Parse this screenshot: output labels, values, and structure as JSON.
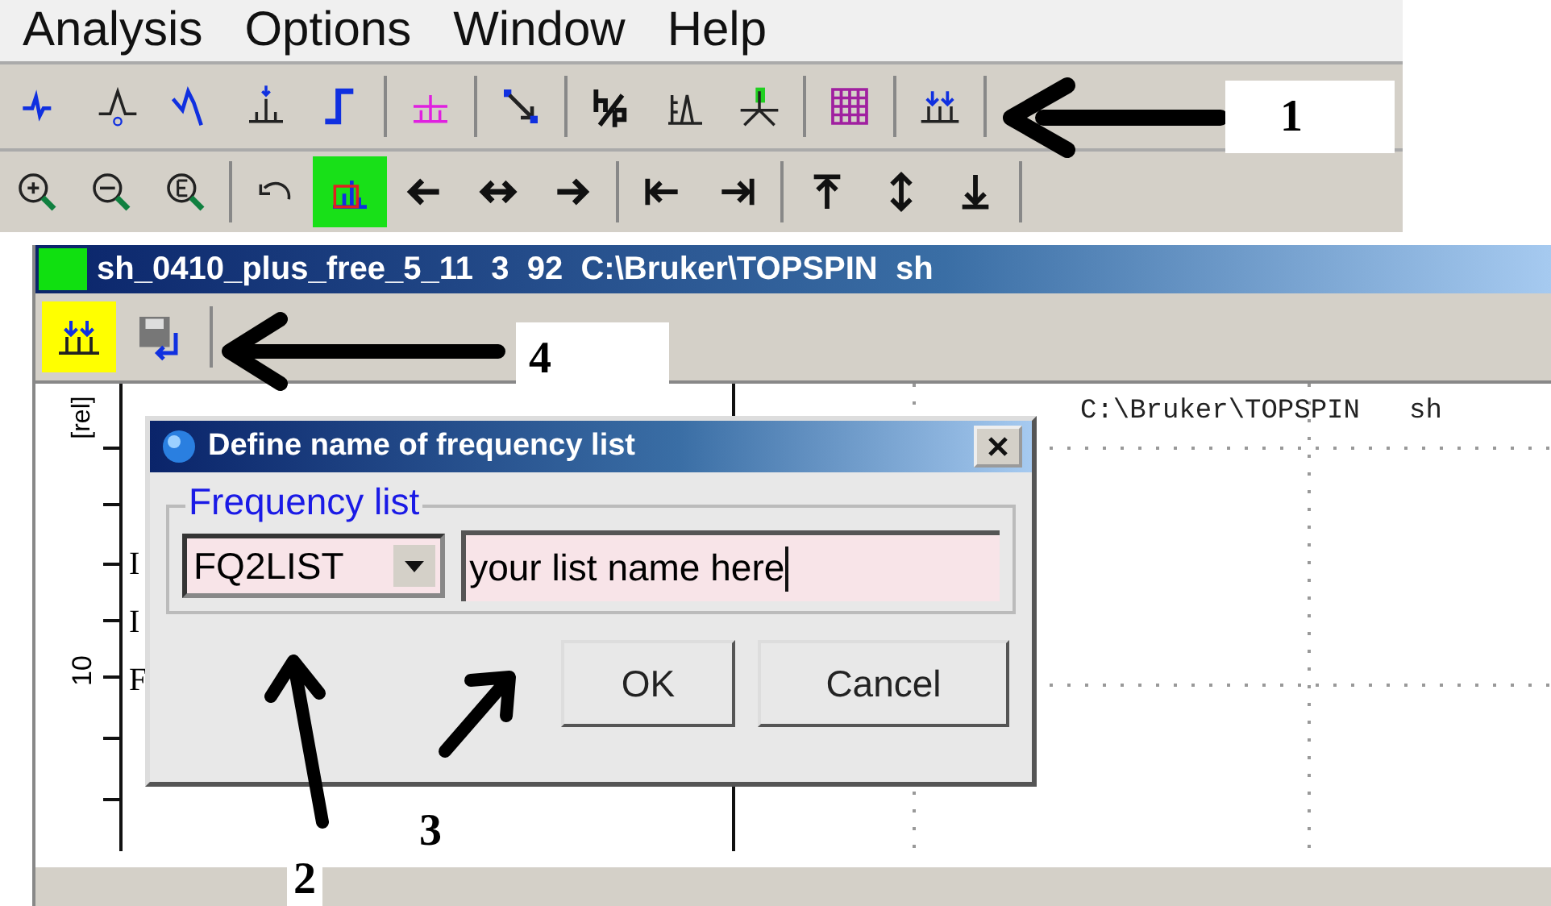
{
  "menu_bar": [
    "Analysis",
    "Options",
    "Window",
    "Help"
  ],
  "toolbar_1": {
    "annotation": "1"
  },
  "toolbar_2": {
    "buttons": [
      {
        "selected": false
      },
      {
        "selected": false
      },
      {
        "selected": false
      },
      {
        "selected": false
      },
      {
        "selected": true
      },
      {
        "selected": false
      },
      {
        "selected": false
      },
      {
        "selected": false
      },
      {
        "selected": false
      },
      {
        "selected": false
      },
      {
        "selected": false
      },
      {
        "selected": false
      },
      {
        "selected": false
      }
    ]
  },
  "spectrum_window": {
    "title": "sh_0410_plus_free_5_11  3  92  C:\\Bruker\\TOPSPIN  sh",
    "toolbar": [
      {
        "selected": true
      },
      {
        "selected": false
      }
    ],
    "annotation": "4"
  },
  "plot": {
    "y_axis_label": "[rel]",
    "y_tick_label": "10",
    "header": "C:\\Bruker\\TOPSPIN   sh",
    "side_letters": [
      "I",
      "I",
      "F"
    ]
  },
  "dialog": {
    "title": "Define name of frequency list",
    "group_label": "Frequency list",
    "list_type": "FQ2LIST",
    "name_field": {
      "value": "your list name here"
    },
    "buttons": [
      "OK",
      "Cancel"
    ],
    "annotations": [
      "2",
      "3"
    ]
  }
}
